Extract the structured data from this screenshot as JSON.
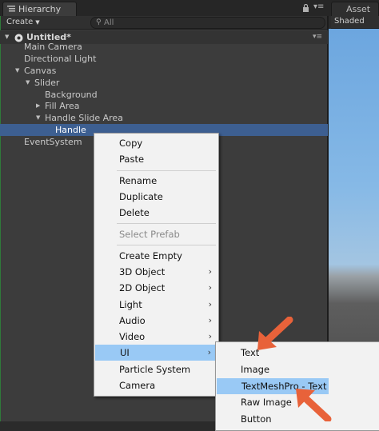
{
  "tabs": {
    "hierarchy": "Hierarchy",
    "asset_store": "Asset S",
    "menu_glyph": "▾≡"
  },
  "toolbar": {
    "create": "Create",
    "search_placeholder": "All",
    "shaded": "Shaded"
  },
  "scene": {
    "name": "Untitled*"
  },
  "tree": [
    {
      "label": "Main Camera"
    },
    {
      "label": "Directional Light"
    },
    {
      "label": "Canvas"
    },
    {
      "label": "Slider"
    },
    {
      "label": "Background"
    },
    {
      "label": "Fill Area"
    },
    {
      "label": "Handle Slide Area"
    },
    {
      "label": "Handle"
    },
    {
      "label": "EventSystem"
    }
  ],
  "context_menu": {
    "items": [
      {
        "label": "Copy"
      },
      {
        "label": "Paste"
      },
      {
        "label": "Rename"
      },
      {
        "label": "Duplicate"
      },
      {
        "label": "Delete"
      },
      {
        "label": "Select Prefab",
        "disabled": true
      },
      {
        "label": "Create Empty"
      },
      {
        "label": "3D Object",
        "submenu": true
      },
      {
        "label": "2D Object",
        "submenu": true
      },
      {
        "label": "Light",
        "submenu": true
      },
      {
        "label": "Audio",
        "submenu": true
      },
      {
        "label": "Video",
        "submenu": true
      },
      {
        "label": "UI",
        "submenu": true,
        "highlighted": true
      },
      {
        "label": "Particle System",
        "submenu": true
      },
      {
        "label": "Camera"
      }
    ],
    "chevron": "›"
  },
  "ui_submenu": {
    "items": [
      {
        "label": "Text"
      },
      {
        "label": "Image"
      },
      {
        "label": "TextMeshPro - Text",
        "highlighted": true
      },
      {
        "label": "Raw Image"
      },
      {
        "label": "Button"
      }
    ]
  },
  "colors": {
    "selection": "#3d5f91",
    "menu_highlight": "#99c9f5",
    "arrow": "#e8623a"
  },
  "icons": [
    "hierarchy-list-icon",
    "lock-icon",
    "unity-scene-icon",
    "search-icon",
    "chevron-right-icon",
    "arrow-annotation"
  ]
}
